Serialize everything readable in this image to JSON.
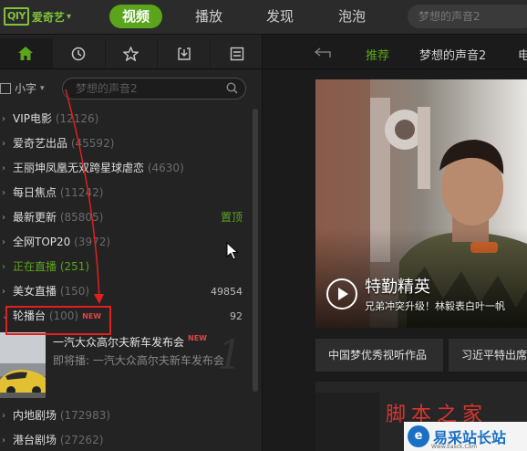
{
  "brand": {
    "logo_mark": "QIY",
    "logo_text": "爱奇艺",
    "chevron": "▾"
  },
  "nav": [
    {
      "label": "视频",
      "active": true
    },
    {
      "label": "播放",
      "active": false
    },
    {
      "label": "发现",
      "active": false
    },
    {
      "label": "泡泡",
      "active": false
    }
  ],
  "top_search": {
    "placeholder": "梦想的声音2"
  },
  "sidebar": {
    "tab_icons": [
      "home-icon",
      "history-clock-icon",
      "favorite-star-icon",
      "download-icon",
      "list-icon"
    ],
    "size_selector": {
      "label": "小字",
      "chevron": "▾"
    },
    "search": {
      "placeholder": "梦想的声音2"
    },
    "items": [
      {
        "arrow": "›",
        "label": "VIP电影",
        "count": "(12126)",
        "right": ""
      },
      {
        "arrow": "›",
        "label": "爱奇艺出品",
        "count": "(45592)",
        "right": ""
      },
      {
        "arrow": "›",
        "label": "王丽坤凤凰无双跨星球虐恋",
        "count": "(4630)",
        "right": ""
      },
      {
        "arrow": "›",
        "label": "每日焦点",
        "count": "(11242)",
        "right": ""
      },
      {
        "arrow": "›",
        "label": "最新更新",
        "count": "(85805)",
        "right": "置顶"
      },
      {
        "arrow": "›",
        "label": "全网TOP20",
        "count": "(3972)",
        "right": ""
      },
      {
        "arrow": "›",
        "label": "正在直播",
        "count": "(251)",
        "right": ""
      },
      {
        "arrow": "›",
        "label": "美女直播",
        "count": "(150)",
        "right": "49854"
      },
      {
        "arrow": "›",
        "label": "轮播台",
        "count": "(100)",
        "badge": "NEW",
        "right": "92"
      }
    ],
    "live_card": {
      "title": "一汽大众高尔夫新车发布会",
      "badge": "NEW",
      "subtitle": "即将播: 一汽大众高尔夫新车发布会",
      "big_number": "1"
    },
    "items_after": [
      {
        "arrow": "›",
        "label": "内地剧场",
        "count": "(172983)"
      },
      {
        "arrow": "›",
        "label": "港台剧场",
        "count": "(27262)"
      }
    ]
  },
  "content": {
    "back_icon": "back-arrow-icon",
    "tabs": [
      {
        "label": "推荐",
        "active": true
      },
      {
        "label": "梦想的声音2",
        "active": false
      },
      {
        "label": "电",
        "active": false
      }
    ],
    "banner": {
      "title": "特勤精英",
      "subtitle": "兄弟冲突升级！林毅表白叶一帆"
    },
    "buttons": [
      "中国梦优秀视听作品",
      "习近平特出席"
    ]
  },
  "watermark": {
    "line1": "脚本之家",
    "line2": "易采站长站",
    "url": "Www.Easck.Com"
  },
  "colors": {
    "accent": "#5aa51b",
    "annotation": "#e02020",
    "new_badge": "#e04545"
  }
}
